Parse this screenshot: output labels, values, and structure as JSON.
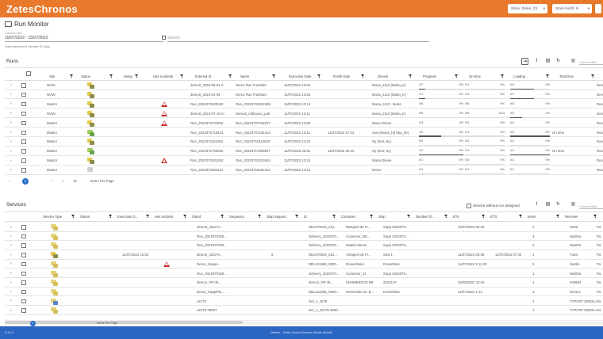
{
  "app": {
    "logo": "ZetesChronos"
  },
  "topbar": {
    "selects": [
      "Store: Zetes_Ch",
      "Store North: N",
      "",
      ""
    ],
    "colors": {
      "bar": "#e8782a",
      "footer": "#2c66c3",
      "accent": "#2a6ec6"
    }
  },
  "page": {
    "title": "Run Monitor",
    "monitor_icon": "monitor-icon",
    "date_label": "Creation date",
    "date_value": "10/07/2022 - 15/07/2022",
    "search_placeholder": "Search",
    "hint": "Data refreshed 8 minutes 31 days"
  },
  "runs": {
    "title": "Runs",
    "filter_placeholder": "Column filter",
    "tools": [
      "export-icon",
      "text-icon",
      "document-icon",
      "refresh-icon"
    ],
    "columns": [
      "Site",
      "Status",
      "Delay",
      "Has incidents",
      "External Id",
      "Name",
      "Execution Date",
      "Finish Date",
      "Drivers",
      "Progress",
      "On-time",
      "Loading",
      "Total time"
    ],
    "rows": [
      {
        "site": "NOW",
        "status": "mixed",
        "delay": "",
        "incident": false,
        "ext": "demo0_2022-05-01-0",
        "name": "Demo Run Frankfurt",
        "exec": "11/07/2022 12:53",
        "finish": "",
        "driver": "Mona_2110 (Maha_K)",
        "prog_n": "1/7",
        "prog_p": "0%",
        "prog_f": 0.15,
        "ot_n": "0/1",
        "ot_p": "0%",
        "load_n": "0/4",
        "load_p": "0%",
        "load_f": 0.6,
        "total": "",
        "extra": "Dem"
      },
      {
        "site": "NOW",
        "status": "mixed",
        "delay": "",
        "incident": false,
        "ext": "demo0_2022-01-04",
        "name": "Demo Run Frankfurt",
        "exec": "11/07/2022 12:53",
        "finish": "",
        "driver": "Mona_2110 (Maha_K)",
        "prog_n": "1/7",
        "prog_p": "0%",
        "prog_f": 0.15,
        "ot_n": "1/1",
        "ot_p": "0%",
        "load_n": "0/7",
        "load_p": "0%",
        "load_f": 0.6,
        "total": "",
        "extra": "Dem"
      },
      {
        "site": "Mastor",
        "status": "mixed",
        "delay": "",
        "incident": true,
        "ext": "Run_2022070100190",
        "name": "Run_20220701001909",
        "exec": "11/07/2022 12:14",
        "finish": "",
        "driver": "Mona_1110 - Mona",
        "prog_n": "0/8",
        "prog_p": "0%",
        "prog_f": 0.0,
        "ot_n": "0/8",
        "ot_p": "0%",
        "load_n": "0/0",
        "load_p": "0%",
        "load_f": 0.0,
        "total": "",
        "extra": "Run"
      },
      {
        "site": "NOW",
        "status": "mixed",
        "delay": "",
        "incident": true,
        "ext": "demo0_2022-07-10-m",
        "name": "Demo0_mbboxeu_pub",
        "exec": "11/07/2022 12:11",
        "finish": "",
        "driver": "Mona_2110 (Maha_K)",
        "prog_n": "0/6",
        "prog_p": "0%",
        "prog_f": 0.0,
        "ot_n": "0/8",
        "ot_p": "0/13",
        "load_n": "0/2",
        "load_p": "0%",
        "load_f": 0.3,
        "total": "",
        "extra": "Dem"
      },
      {
        "site": "Master",
        "status": "mixed",
        "delay": "",
        "incident": true,
        "ext": "Run_2022070701832",
        "name": "Run_20220707018327",
        "exec": "11/07/2022 12:50",
        "finish": "",
        "driver": "Mona Drivee",
        "prog_n": "0/3",
        "prog_p": "0%",
        "prog_f": 0.0,
        "ot_n": "0/0",
        "ot_p": "0%",
        "load_n": "0/1",
        "load_p": "0%",
        "load_f": 0.0,
        "total": "",
        "extra": "Run"
      },
      {
        "site": "Master",
        "status": "green",
        "delay": "",
        "incident": false,
        "ext": "Run_2022070710441",
        "name": "Run_20220707104414",
        "exec": "11/07/2022 13:11",
        "finish": "11/07/2022 17:44",
        "driver": "Sow (Mona_Hij bba_thr)",
        "prog_n": "1/2",
        "prog_p": "0%",
        "prog_f": 0.5,
        "ot_n": "2/1",
        "ot_p": "0%",
        "load_n": "2/2",
        "load_p": "0%",
        "load_f": 1.0,
        "total": "On time",
        "extra": "Run"
      },
      {
        "site": "Mastor",
        "status": "mixed",
        "delay": "",
        "incident": false,
        "ext": "Run_2022071101462",
        "name": "Run_20220710114623",
        "exec": "11/07/2022 14:22",
        "finish": "",
        "driver": "Ny (test, Ny)",
        "prog_n": "0/9",
        "prog_p": "0%",
        "prog_f": 0.0,
        "ot_n": "0/5",
        "ot_p": "0%",
        "load_n": "0/1",
        "load_p": "0%",
        "load_f": 0.0,
        "total": "",
        "extra": "Run"
      },
      {
        "site": "Mastor",
        "status": "green",
        "delay": "",
        "incident": false,
        "ext": "Run_2022071700052",
        "name": "Run_20220717000527",
        "exec": "11/07/2022 20:51",
        "finish": "11/07/2022 20:44",
        "driver": "Ny (test, Ny)",
        "prog_n": "1/1",
        "prog_p": "0%",
        "prog_f": 1.0,
        "ot_n": "1/1",
        "ot_p": "0%",
        "load_n": "1/1",
        "load_p": "0%",
        "load_f": 1.0,
        "total": "On time",
        "extra": "Run"
      },
      {
        "site": "Mastor",
        "status": "mixed",
        "delay": "",
        "incident": true,
        "ext": "Run_2022070101262",
        "name": "Run_20220701012624",
        "exec": "11/07/2022 12:24",
        "finish": "",
        "driver": "Mona Drivee",
        "prog_n": "0/1",
        "prog_p": "0%",
        "prog_f": 0.0,
        "ot_n": "0/4",
        "ot_p": "0%",
        "load_n": "0/1",
        "load_p": "0%",
        "load_f": 0.0,
        "total": "",
        "extra": "Run"
      },
      {
        "site": "Mastor",
        "status": "grey",
        "delay": "",
        "incident": false,
        "ext": "Run_2022071500122",
        "name": "Run_20220715001226",
        "exec": "11/07/2022 13:12",
        "finish": "",
        "driver": "Driver",
        "prog_n": "0/1",
        "prog_p": "0%",
        "prog_f": 0.0,
        "ot_n": "0/1",
        "ot_p": "0%",
        "load_n": "0/1",
        "load_p": "0%",
        "load_f": 0.0,
        "total": "",
        "extra": "Run"
      }
    ],
    "pager": {
      "prev": "‹",
      "page": "1",
      "next": "›",
      "last": "»",
      "size": "10",
      "label": "Items Per Page"
    }
  },
  "services": {
    "title": "Services",
    "without_run_label": "Service without run assigned",
    "filter_placeholder": "Column filter",
    "tools": [
      "text-icon",
      "document-icon",
      "refresh-icon"
    ],
    "columns": [
      "Service Type",
      "Status",
      "Execution D...",
      "Has Incident",
      "Stand",
      "Sequence",
      "Stop Sequen...",
      "Id",
      "Customer",
      "Stop",
      "Number Of...",
      "ETA",
      "ETD",
      "Items",
      "Receiver"
    ],
    "rows": [
      {
        "type": "yellow",
        "status": "",
        "exec": "",
        "incident": false,
        "stand": "demo0_2022-0...",
        "seq": "",
        "stopseq": "",
        "id": "DEL870643_012...",
        "customer": "Mangeot de Fr...",
        "stop": "Sopp 2022070...",
        "number": "",
        "eta": "11/07/2022 05:30",
        "etd": "",
        "items": "1",
        "receiver": "Sarta",
        "extra": "Pa"
      },
      {
        "type": "yellow",
        "status": "",
        "exec": "",
        "incident": false,
        "stand": "Run_2022070100...",
        "seq": "",
        "stopseq": "",
        "id": "Delivery_2022070...",
        "customer": "Customer_BS...",
        "stop": "Sopp 2022070...",
        "number": "",
        "eta": "",
        "etd": "",
        "items": "3",
        "receiver": "Maritha",
        "extra": "Pa"
      },
      {
        "type": "yellow",
        "status": "",
        "exec": "",
        "incident": false,
        "stand": "Run_2022070100...",
        "seq": "",
        "stopseq": "",
        "id": "Delivery_2022070...",
        "customer": "Matela Meron",
        "stop": "Sopp 2022070...",
        "number": "",
        "eta": "",
        "etd": "",
        "items": "2",
        "receiver": "Maritha",
        "extra": "Pa"
      },
      {
        "type": "mixed",
        "status": "",
        "exec": "11/07/2022 12:53",
        "incident": false,
        "stand": "demo0_2022-0...",
        "seq": "",
        "stopseq": "6",
        "id": "DEL870643_012...",
        "customer": "Amagest de Fr...",
        "stop": "Sow 1",
        "number": "",
        "eta": "11/07/2022 05:36",
        "etd": "11/07/2022 07:30",
        "items": "1",
        "receiver": "Turta",
        "extra": "Pa"
      },
      {
        "type": "yellow",
        "status": "",
        "exec": "",
        "incident": true,
        "stand": "Demo_Happe...",
        "seq": "",
        "stopseq": "",
        "id": "DEL123456_0000...",
        "customer": "Rosenthaler",
        "stop": "Rosenthan",
        "number": "",
        "eta": "11/07/2022 5 11:33",
        "etd": "",
        "items": "3",
        "receiver": "Sarthe",
        "extra": "Pa"
      },
      {
        "type": "yellow",
        "status": "",
        "exec": "",
        "incident": false,
        "stand": "Run_2022070100...",
        "seq": "",
        "stopseq": "",
        "id": "Delivery_2022070...",
        "customer": "Customer_21",
        "stop": "Sopp 2022070...",
        "number": "",
        "eta": "",
        "etd": "",
        "items": "1",
        "receiver": "Maritha",
        "extra": "Pa"
      },
      {
        "type": "yellow",
        "status": "",
        "exec": "",
        "incident": false,
        "stand": "demo2_FR:40...",
        "seq": "",
        "stopseq": "",
        "id": "demo2_FR:40...",
        "customer": "SHHMEROVZ DE",
        "stop": "2224107",
        "number": "",
        "eta": "15/05/2022 12:43",
        "etd": "",
        "items": "1",
        "receiver": "400683",
        "extra": "Pa"
      },
      {
        "type": "yellow",
        "status": "",
        "exec": "",
        "incident": false,
        "stand": "Demo_HappiPlu...",
        "seq": "",
        "stopseq": "",
        "id": "DEL123456_0000...",
        "customer": "Rosenthan Dr. B...",
        "stop": "Rosenthan",
        "number": "",
        "eta": "11/07/2022 1:13",
        "etd": "",
        "items": "3",
        "receiver": "Drivers",
        "extra": "Pa"
      },
      {
        "type": "blue",
        "status": "",
        "exec": "",
        "incident": false,
        "stand": "42170",
        "seq": "",
        "stopseq": "",
        "id": "Del_1_4279",
        "customer": "",
        "stop": "",
        "number": "",
        "eta": "",
        "etd": "",
        "items": "1",
        "receiver": "TYPOST ZIMOLI...",
        "extra": "Pa"
      },
      {
        "type": "yellow",
        "status": "",
        "exec": "",
        "incident": false,
        "stand": "42178-45007",
        "seq": "",
        "stopseq": "",
        "id": "Del_1_42178-4500...",
        "customer": "",
        "stop": "",
        "number": "",
        "eta": "",
        "etd": "",
        "items": "1",
        "receiver": "TYPOST ZIMOLI...",
        "extra": "Pa"
      }
    ],
    "pager": {
      "page": "1",
      "label": "Items Per Page"
    }
  },
  "footer": {
    "left": "6.14.0",
    "center": "Meters - Zetes ZetesChronos Mobile Mobile"
  }
}
